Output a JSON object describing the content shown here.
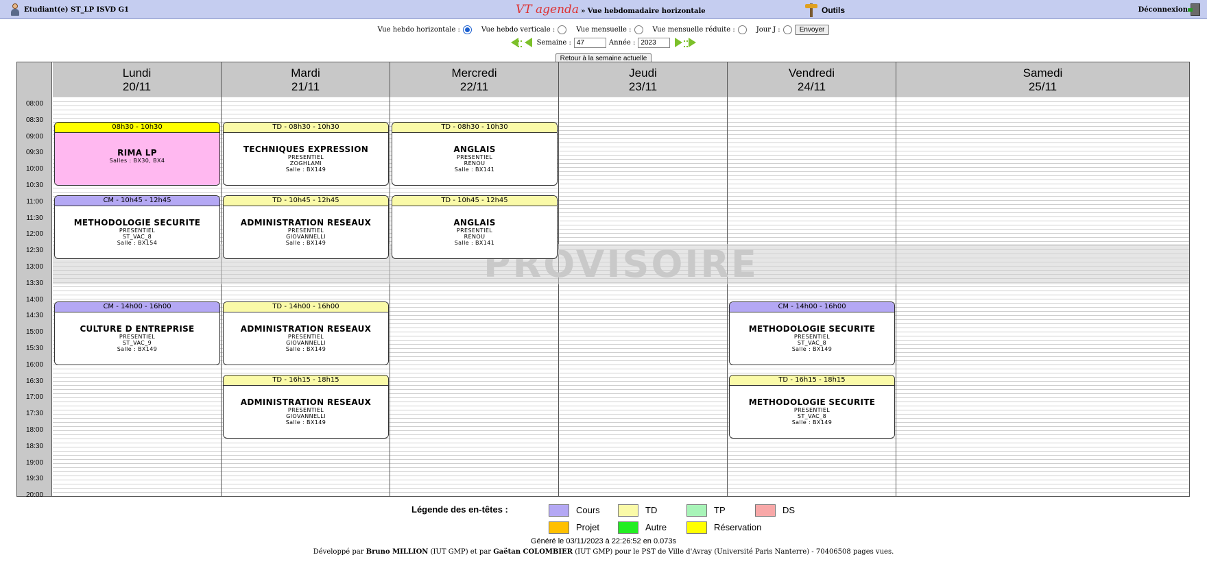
{
  "topbar": {
    "user": "Etudiant(e) ST_LP ISVD G1",
    "brand": "VT agenda",
    "title": "» Vue hebdomadaire horizontale",
    "tools": "Outils",
    "logout": "Déconnexion"
  },
  "views": {
    "horizontal": "Vue hebdo horizontale :",
    "vertical": "Vue hebdo verticale :",
    "monthly": "Vue mensuelle :",
    "monthly_reduced": "Vue mensuelle réduite :",
    "day": "Jour J :",
    "selected": "horizontal",
    "send": "Envoyer"
  },
  "week_nav": {
    "week_label": "Semaine :",
    "week": "47",
    "year_label": "Année :",
    "year": "2023",
    "back": "Retour à la semaine actuelle"
  },
  "times": [
    "08:00",
    "08:30",
    "09:00",
    "09:30",
    "10:00",
    "10:30",
    "11:00",
    "11:30",
    "12:00",
    "12:30",
    "13:00",
    "13:30",
    "14:00",
    "14:30",
    "15:00",
    "15:30",
    "16:00",
    "16:30",
    "17:00",
    "17:30",
    "18:00",
    "18:30",
    "19:00",
    "19:30",
    "20:00"
  ],
  "days": [
    {
      "name": "Lundi",
      "date": "20/11"
    },
    {
      "name": "Mardi",
      "date": "21/11"
    },
    {
      "name": "Mercredi",
      "date": "22/11"
    },
    {
      "name": "Jeudi",
      "date": "23/11"
    },
    {
      "name": "Vendredi",
      "date": "24/11"
    },
    {
      "name": "Samedi",
      "date": "25/11"
    }
  ],
  "watermark": "PROVISOIRE",
  "events": [
    {
      "day": 0,
      "start": "08:30",
      "end": "10:30",
      "header": "08h30 - 10h30",
      "type": "Réservation",
      "title": "RIMA LP",
      "lines": [
        "Salles : BX30, BX4"
      ],
      "body_color": "#ffb8f0"
    },
    {
      "day": 0,
      "start": "10:45",
      "end": "12:45",
      "header": "CM - 10h45 - 12h45",
      "type": "Cours",
      "title": "METHODOLOGIE SECURITE",
      "lines": [
        "PRESENTIEL",
        "ST_VAC_8",
        "Salle : BX154"
      ]
    },
    {
      "day": 0,
      "start": "14:00",
      "end": "16:00",
      "header": "CM - 14h00 - 16h00",
      "type": "Cours",
      "title": "CULTURE D ENTREPRISE",
      "lines": [
        "PRESENTIEL",
        "ST_VAC_9",
        "Salle : BX149"
      ]
    },
    {
      "day": 1,
      "start": "08:30",
      "end": "10:30",
      "header": "TD - 08h30 - 10h30",
      "type": "TD",
      "title": "TECHNIQUES EXPRESSION",
      "lines": [
        "PRESENTIEL",
        "ZOGHLAMI",
        "Salle : BX149"
      ]
    },
    {
      "day": 1,
      "start": "10:45",
      "end": "12:45",
      "header": "TD - 10h45 - 12h45",
      "type": "TD",
      "title": "ADMINISTRATION RESEAUX",
      "lines": [
        "PRESENTIEL",
        "GIOVANNELLI",
        "Salle : BX149"
      ]
    },
    {
      "day": 1,
      "start": "14:00",
      "end": "16:00",
      "header": "TD - 14h00 - 16h00",
      "type": "TD",
      "title": "ADMINISTRATION RESEAUX",
      "lines": [
        "PRESENTIEL",
        "GIOVANNELLI",
        "Salle : BX149"
      ]
    },
    {
      "day": 1,
      "start": "16:15",
      "end": "18:15",
      "header": "TD - 16h15 - 18h15",
      "type": "TD",
      "title": "ADMINISTRATION RESEAUX",
      "lines": [
        "PRESENTIEL",
        "GIOVANNELLI",
        "Salle : BX149"
      ]
    },
    {
      "day": 2,
      "start": "08:30",
      "end": "10:30",
      "header": "TD - 08h30 - 10h30",
      "type": "TD",
      "title": "ANGLAIS",
      "lines": [
        "PRESENTIEL",
        "RENOU",
        "Salle : BX141"
      ]
    },
    {
      "day": 2,
      "start": "10:45",
      "end": "12:45",
      "header": "TD - 10h45 - 12h45",
      "type": "TD",
      "title": "ANGLAIS",
      "lines": [
        "PRESENTIEL",
        "RENOU",
        "Salle : BX141"
      ]
    },
    {
      "day": 4,
      "start": "14:00",
      "end": "16:00",
      "header": "CM - 14h00 - 16h00",
      "type": "Cours",
      "title": "METHODOLOGIE SECURITE",
      "lines": [
        "PRESENTIEL",
        "ST_VAC_8",
        "Salle : BX149"
      ]
    },
    {
      "day": 4,
      "start": "16:15",
      "end": "18:15",
      "header": "TD - 16h15 - 18h15",
      "type": "TD",
      "title": "METHODOLOGIE SECURITE",
      "lines": [
        "PRESENTIEL",
        "ST_VAC_8",
        "Salle : BX149"
      ]
    }
  ],
  "legend": {
    "title": "Légende des en-têtes :",
    "items": [
      {
        "label": "Cours",
        "color": "#b4a8f4"
      },
      {
        "label": "TD",
        "color": "#fafaa8"
      },
      {
        "label": "TP",
        "color": "#a8f4b8"
      },
      {
        "label": "DS",
        "color": "#f8a8a8"
      },
      {
        "label": "Projet",
        "color": "#ffc000"
      },
      {
        "label": "Autre",
        "color": "#22ee22"
      },
      {
        "label": "Réservation",
        "color": "#ffff00"
      }
    ]
  },
  "footer": {
    "generated": "Généré le 03/11/2023 à 22:26:52 en 0.073s",
    "dev_prefix": "Développé par",
    "author1": "Bruno MILLION",
    "mid": "(IUT GMP) et par",
    "author2": "Gaëtan COLOMBIER",
    "suffix": "(IUT GMP) pour le PST de Ville d'Avray (Université Paris Nanterre) - 70406508 pages vues."
  }
}
